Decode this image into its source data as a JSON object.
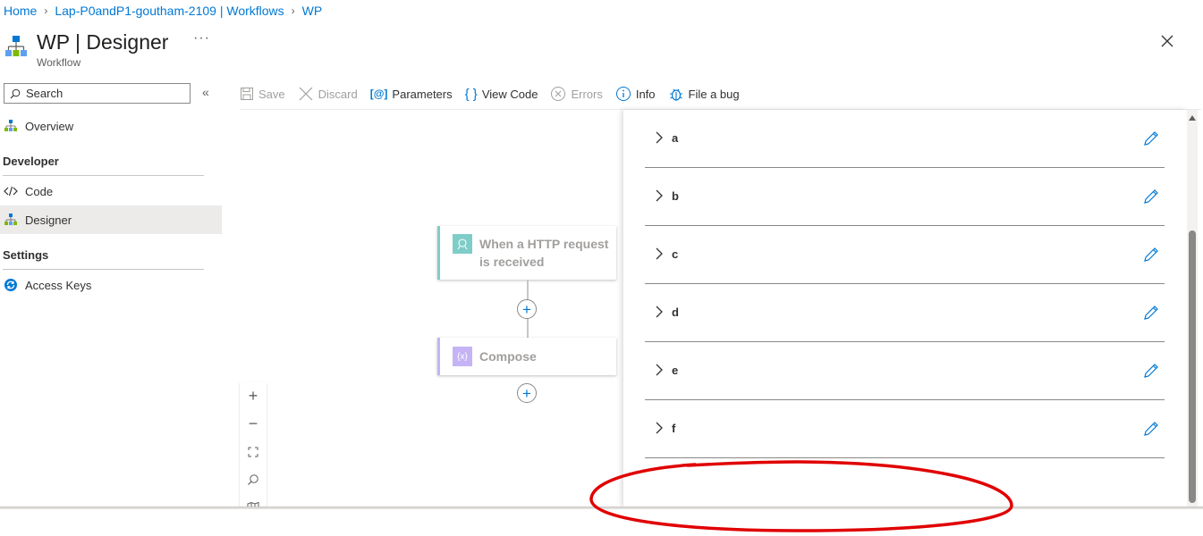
{
  "breadcrumb": {
    "items": [
      "Home",
      "Lap-P0andP1-goutham-2109 | Workflows",
      "WP"
    ]
  },
  "header": {
    "title": "WP | Designer",
    "subtitle": "Workflow",
    "more": "···"
  },
  "sidebar": {
    "search_placeholder": "Search",
    "items": {
      "overview": "Overview",
      "developer_heading": "Developer",
      "code": "Code",
      "designer": "Designer",
      "settings_heading": "Settings",
      "access_keys": "Access Keys"
    },
    "selected": "Designer"
  },
  "toolbar": {
    "save": "Save",
    "discard": "Discard",
    "parameters": "Parameters",
    "view_code": "View Code",
    "errors": "Errors",
    "info": "Info",
    "file_bug": "File a bug"
  },
  "workflow": {
    "trigger": "When a HTTP request is received",
    "trigger_line1": "When a HTTP request",
    "trigger_line2": "is received",
    "action": "Compose",
    "trigger_color": "#7fcdc9",
    "action_color": "#c5b3f5"
  },
  "parameters_panel": {
    "rows": [
      "a",
      "b",
      "c",
      "d",
      "e",
      "f"
    ]
  },
  "colors": {
    "accent": "#0078d4",
    "annotation": "#e00000"
  }
}
